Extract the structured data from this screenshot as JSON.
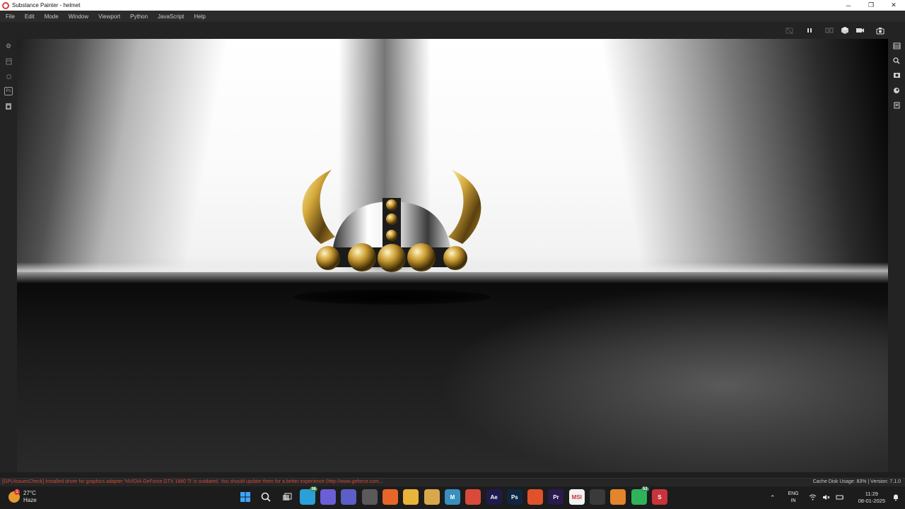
{
  "window": {
    "title": "Substance Painter - helmet",
    "minimize": "─",
    "maximize": "❐",
    "close": "✕"
  },
  "menubar": {
    "items": [
      "File",
      "Edit",
      "Mode",
      "Window",
      "Viewport",
      "Python",
      "JavaScript",
      "Help"
    ]
  },
  "toolbar": {
    "icons": [
      "hide-ui-icon",
      "pause-icon",
      "split-view-icon",
      "3d-view-icon",
      "camera-icon",
      "screenshot-icon"
    ]
  },
  "left_dock": {
    "icons": [
      "settings-icon",
      "shelf-icon",
      "layer-icon",
      "photoshop-icon",
      "export-icon"
    ],
    "ps_label": "Ps"
  },
  "right_dock": {
    "icons": [
      "layers-panel-icon",
      "zoom-icon",
      "display-settings-icon",
      "environment-icon",
      "document-icon"
    ]
  },
  "status": {
    "message": "[GPUIssuesCheck] Installed driver for graphics adapter 'NVIDIA GeForce GTX 1660 Ti' is outdated. You should update them for a better experience (http://www.geforce.com...",
    "cache": "Cache Disk Usage:   83% | Version: 7.1.0"
  },
  "taskbar": {
    "weather_temp": "27°C",
    "weather_desc": "Haze",
    "weather_badge": "1",
    "apps": [
      {
        "name": "windows-start-icon",
        "label": "",
        "color": "#2f7fd4",
        "count": ""
      },
      {
        "name": "search-icon",
        "label": "",
        "color": "transparent",
        "count": ""
      },
      {
        "name": "task-view-icon",
        "label": "",
        "color": "transparent",
        "count": ""
      },
      {
        "name": "telegram-icon",
        "label": "",
        "color": "#2a9fd8",
        "count": "38"
      },
      {
        "name": "copilot-icon",
        "label": "",
        "color": "#6a5fd6",
        "count": ""
      },
      {
        "name": "teams-icon",
        "label": "",
        "color": "#5b5fc7",
        "count": ""
      },
      {
        "name": "settings-icon",
        "label": "",
        "color": "#5a5a5a",
        "count": ""
      },
      {
        "name": "firefox-icon",
        "label": "",
        "color": "#e8662a",
        "count": ""
      },
      {
        "name": "file-explorer-icon",
        "label": "",
        "color": "#e8b43a",
        "count": ""
      },
      {
        "name": "substance-designer-icon",
        "label": "",
        "color": "#d9a84a",
        "count": ""
      },
      {
        "name": "maps-icon",
        "label": "M",
        "color": "#3a8fbf",
        "count": ""
      },
      {
        "name": "chrome-icon",
        "label": "",
        "color": "#d94a3a",
        "count": ""
      },
      {
        "name": "after-effects-icon",
        "label": "Ae",
        "color": "#1f1a4d",
        "count": ""
      },
      {
        "name": "photoshop-icon",
        "label": "Ps",
        "color": "#0f2640",
        "count": ""
      },
      {
        "name": "brave-icon",
        "label": "",
        "color": "#e0532a",
        "count": ""
      },
      {
        "name": "premiere-icon",
        "label": "Pr",
        "color": "#2a1a4d",
        "count": ""
      },
      {
        "name": "msi-icon",
        "label": "MSI",
        "color": "#f2f2f2",
        "count": ""
      },
      {
        "name": "unity-icon",
        "label": "",
        "color": "#3a3a3a",
        "count": ""
      },
      {
        "name": "blender-icon",
        "label": "",
        "color": "#e3852a",
        "count": ""
      },
      {
        "name": "whatsapp-icon",
        "label": "",
        "color": "#2fb35a",
        "count": "53"
      },
      {
        "name": "substance-painter-icon",
        "label": "S",
        "color": "#c7343a",
        "count": ""
      }
    ],
    "lang": "ENG",
    "region": "IN",
    "time": "11:29",
    "date": "08-01-2025"
  }
}
